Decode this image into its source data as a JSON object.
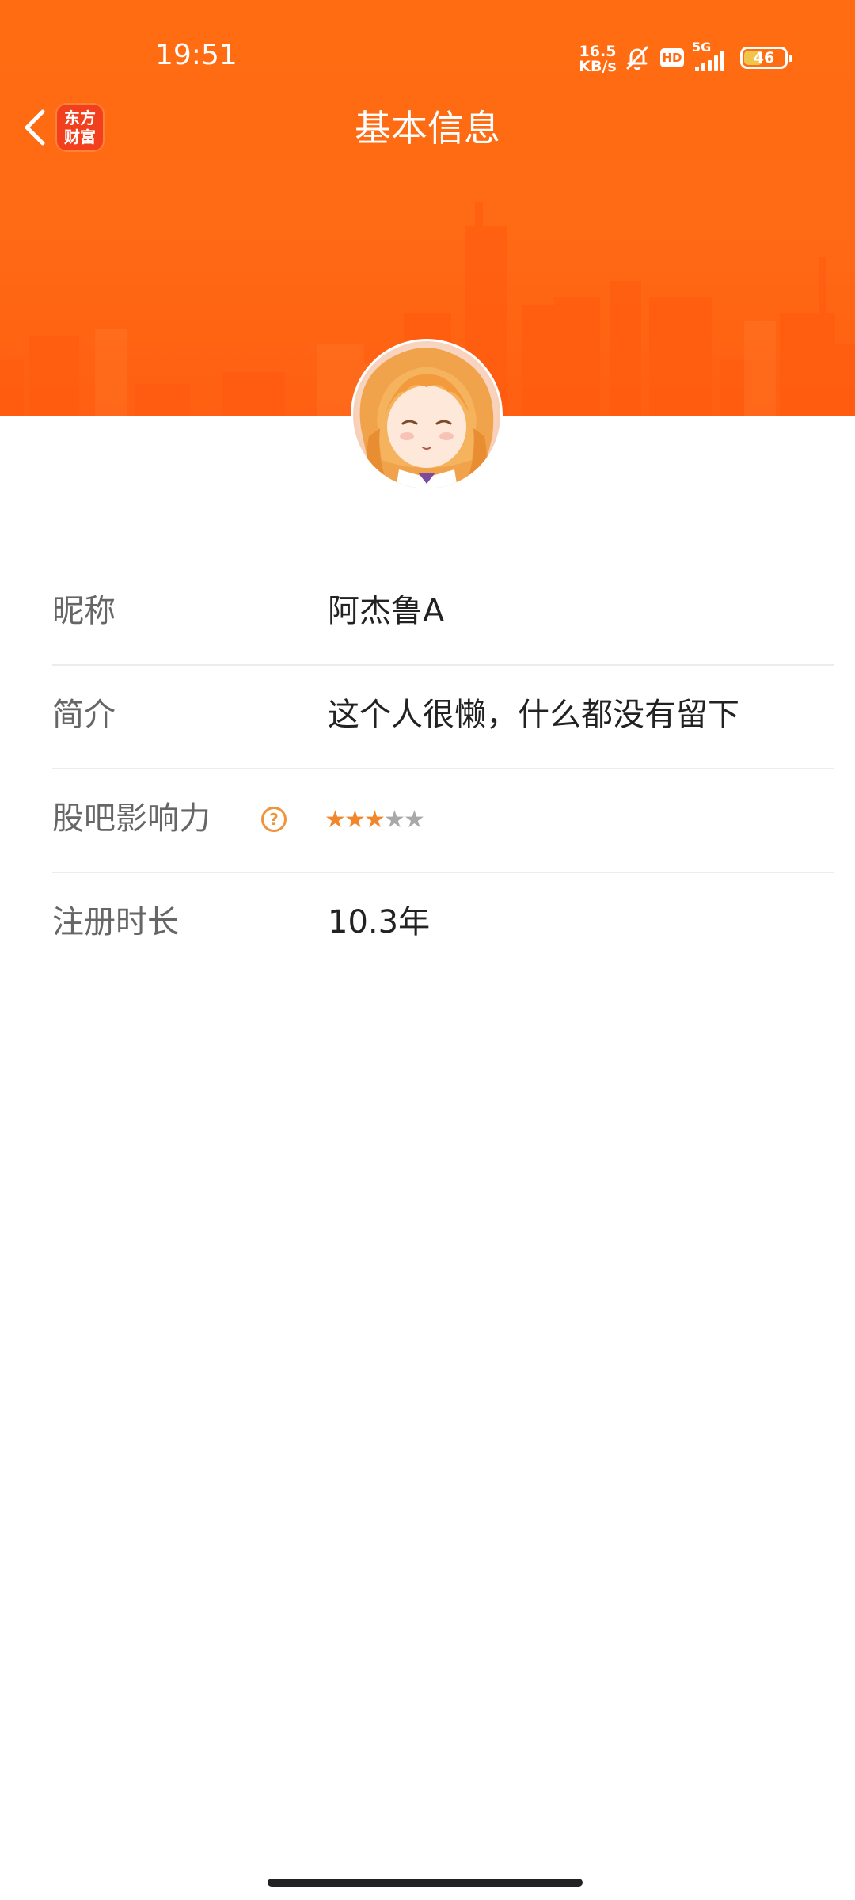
{
  "status_bar": {
    "time": "19:51",
    "network_speed_top": "16.5",
    "network_speed_bottom": "KB/s",
    "hd_label": "HD",
    "signal_label": "5G",
    "battery": "46",
    "battery_level": 0.46,
    "icons": [
      "mute-bell-icon",
      "hd-icon",
      "5g-signal-icon",
      "battery-icon"
    ]
  },
  "nav": {
    "title": "基本信息",
    "back_icon": "chevron-left-icon",
    "logo_line1": "东方",
    "logo_line2": "财富"
  },
  "profile": {
    "rows": [
      {
        "label": "昵称",
        "value": "阿杰鲁A"
      },
      {
        "label": "简介",
        "value": "这个人很懒，什么都没有留下"
      },
      {
        "label": "股吧影响力",
        "help_icon": "?",
        "stars_filled": 3,
        "stars_total": 5
      },
      {
        "label": "注册时长",
        "value": "10.3年"
      }
    ]
  },
  "colors": {
    "header": "#ff6a14",
    "accent": "#f2862b",
    "logo": "#f2401e"
  }
}
